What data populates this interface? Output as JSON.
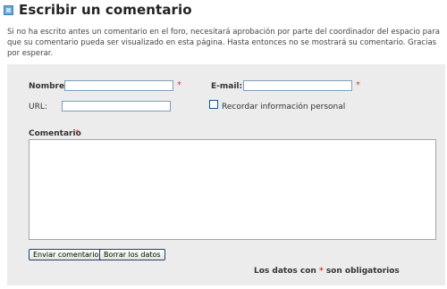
{
  "header": {
    "title": "Escribir un comentario"
  },
  "intro": "Si no ha escrito antes un comentario en el foro, necesitará aprobación por parte del coordinador del espacio para que su comentario pueda ser visualizado en esta página. Hasta entonces no se mostrará su comentario. Gracias por esperar.",
  "form": {
    "name_label": "Nombre:",
    "email_label": "E-mail:",
    "url_label": "URL:",
    "remember_label": "Recordar información personal",
    "comment_label": "Comentario",
    "required_marker": "*",
    "name_value": "",
    "email_value": "",
    "url_value": "",
    "comment_value": "",
    "submit_label": "Enviar comentario",
    "clear_label": "Borrar los datos",
    "required_note_prefix": "Los datos con",
    "required_note_suffix": "son obligatorios"
  },
  "colors": {
    "accent_required": "#dd3333",
    "panel_bg": "#ececec",
    "icon_blue": "#6aa8d8"
  },
  "icons": [
    "square-bullet-icon"
  ]
}
